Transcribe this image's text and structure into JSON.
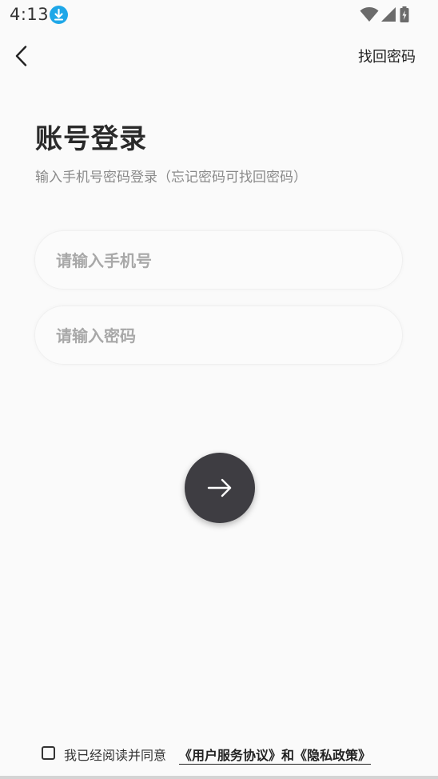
{
  "status_bar": {
    "time": "4:13",
    "icons": [
      "download-icon",
      "wifi-icon",
      "signal-icon",
      "battery-icon"
    ],
    "badge_color": "#1ea7e8"
  },
  "nav": {
    "back_icon": "chevron-left-icon",
    "recover_label": "找回密码"
  },
  "header": {
    "title": "账号登录",
    "subtitle": "输入手机号密码登录（忘记密码可找回密码）"
  },
  "form": {
    "phone_placeholder": "请输入手机号",
    "phone_value": "",
    "password_placeholder": "请输入密码",
    "password_value": "",
    "submit_icon": "arrow-right-icon",
    "submit_color": "#3e3d42"
  },
  "agreement": {
    "checked": false,
    "text": "我已经阅读并同意",
    "links": "《用户服务协议》和《隐私政策》"
  }
}
